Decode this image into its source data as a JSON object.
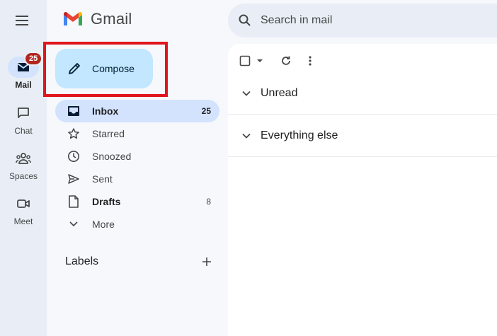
{
  "rail": {
    "items": [
      {
        "label": "Mail",
        "badge": "25"
      },
      {
        "label": "Chat"
      },
      {
        "label": "Spaces"
      },
      {
        "label": "Meet"
      }
    ]
  },
  "logo": {
    "text": "Gmail"
  },
  "compose": {
    "label": "Compose"
  },
  "nav": {
    "items": [
      {
        "label": "Inbox",
        "count": "25"
      },
      {
        "label": "Starred"
      },
      {
        "label": "Snoozed"
      },
      {
        "label": "Sent"
      },
      {
        "label": "Drafts",
        "count": "8"
      },
      {
        "label": "More"
      }
    ]
  },
  "labels": {
    "title": "Labels"
  },
  "search": {
    "placeholder": "Search in mail"
  },
  "sections": [
    {
      "label": "Unread"
    },
    {
      "label": "Everything else"
    }
  ],
  "colors": {
    "accent": "#c2e7ff",
    "active": "#d3e3fd",
    "badge": "#b3261e",
    "highlight": "#e0161c"
  }
}
